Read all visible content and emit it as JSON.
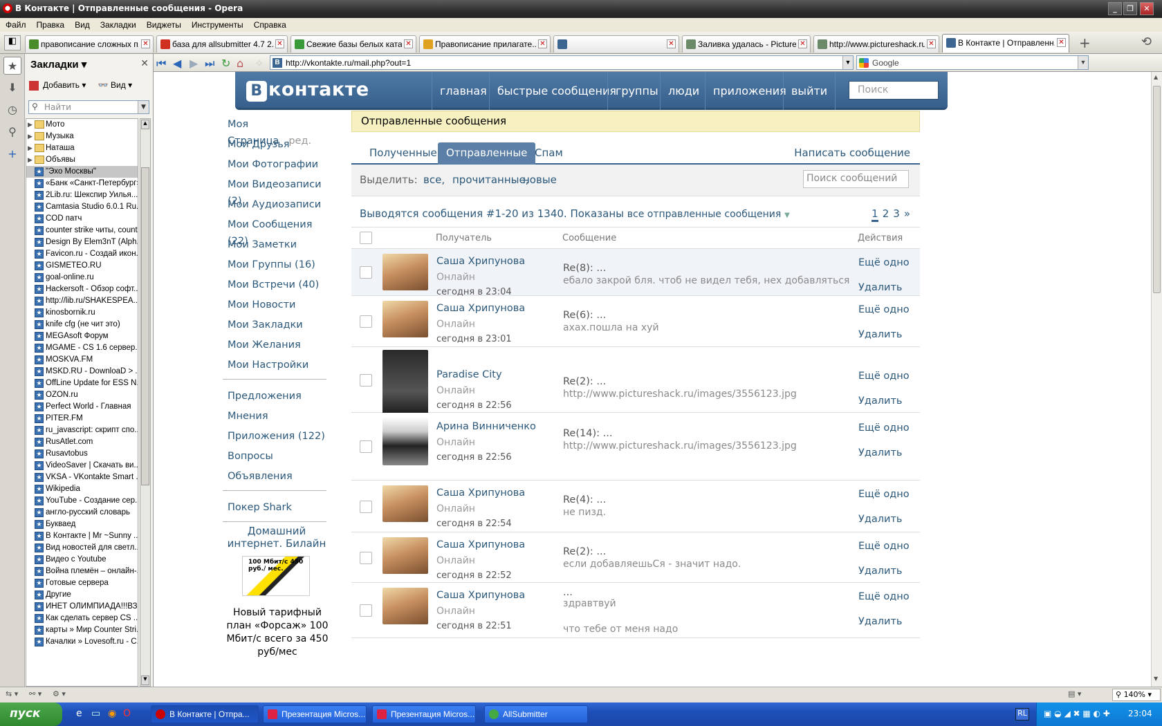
{
  "window": {
    "title": "В Контакте | Отправленные сообщения - Opera"
  },
  "menu": [
    "Файл",
    "Правка",
    "Вид",
    "Закладки",
    "Виджеты",
    "Инструменты",
    "Справка"
  ],
  "tabs": [
    {
      "label": "правописание сложных п...",
      "color": "#4a8c2a"
    },
    {
      "label": "база для allsubmitter 4.7 2...",
      "color": "#d03020"
    },
    {
      "label": "Свежие базы белых ката...",
      "color": "#3a9a3a"
    },
    {
      "label": "Правописание прилагате...",
      "color": "#e0a020"
    },
    {
      "label": "",
      "color": "#3d6592"
    },
    {
      "label": "Заливка удалась - Picture...",
      "color": "#6a8a6a"
    },
    {
      "label": "http://www.pictureshack.ru...",
      "color": "#6a8a6a"
    },
    {
      "label": "В Контакте | Отправленн...",
      "color": "#3d6592"
    }
  ],
  "bookmarks": {
    "title": "Закладки",
    "add": "Добавить",
    "view": "Вид",
    "search_placeholder": "Найти",
    "folders": [
      "Мото",
      "Музыка",
      "Наташа",
      "Объявы"
    ],
    "items": [
      "\"Эхо Москвы\"",
      "«Банк «Санкт-Петербург»",
      "2Lib.ru: Шекспир Уилья...",
      "Camtasia Studio 6.0.1 Ru...",
      "COD  патч",
      "counter strike читы, count...",
      "Design By Elem3nT (Alph...",
      "Favicon.ru - Создай икон...",
      "GISMETEO.RU",
      "goal-online.ru",
      "Hackersoft - Обзор софт...",
      "http://lib.ru/SHAKESPEA...",
      "kinosbornik.ru",
      "knife cfg (не чит это)",
      "MEGAsoft Форум",
      "MGAME - CS 1.6 сервер...",
      "MOSKVA.FM",
      "MSKD.RU - DownloaD > ...",
      "OffLine Update for ESS N...",
      "OZON.ru",
      "Perfect World - Главная",
      "PITER.FM",
      "ru_javascript: скрипт спо...",
      "RusAtlet.com",
      "Rusavtobus",
      "VideoSaver | Скачать ви...",
      "VKSA - VKontakte Smart ...",
      "Wikipedia",
      "YouTube - Создание сер...",
      "англо-русский словарь",
      "Букваед",
      "В Контакте | Mr ~Sunny ...",
      "Вид новостей для светл...",
      "Видео с Youtube",
      "Война племён – онлайн-...",
      "Готовые сервера",
      "Другие",
      "ИНЕТ ОЛИМПИАДА!!!ВЗ...",
      "Как сделать сервер CS ...",
      "карты » Мир Counter Stri...",
      "Качалки » Lovesoft.ru - С..."
    ]
  },
  "address": {
    "url": "http://vkontakte.ru/mail.php?out=1",
    "search": "Google"
  },
  "vk": {
    "logo": "контакте",
    "logo_letter": "В",
    "nav": [
      "главная",
      "быстрые сообщения",
      "группы",
      "люди",
      "приложения",
      "выйти"
    ],
    "search_placeholder": "Поиск",
    "left_menu": [
      "Моя Страница",
      "Мои Друзья",
      "Мои Фотографии",
      "Мои Видеозаписи (2)",
      "Мои Аудиозаписи",
      "Мои Сообщения (22)",
      "Мои Заметки",
      "Мои Группы (16)",
      "Мои Встречи (40)",
      "Мои Новости",
      "Мои Закладки",
      "Мои Желания",
      "Мои Настройки"
    ],
    "edit_label": "ред.",
    "left_menu2": [
      "Предложения",
      "Мнения",
      "Приложения (122)",
      "Вопросы",
      "Объявления"
    ],
    "left_menu3": [
      "Покер Shark"
    ],
    "ad": {
      "title": "Домашний интернет. Билайн",
      "img_text": "100 Мбит/с 450 руб./ мес.",
      "text": "Новый тарифный план «Форсаж» 100 Мбит/с всего за 450 руб/мес"
    },
    "header": "Отправленные сообщения",
    "mail_tabs": [
      "Полученные",
      "Отправленные",
      "Спам"
    ],
    "compose": "Написать сообщение",
    "filter": {
      "label": "Выделить:",
      "links": [
        "все,",
        "прочитанные,",
        "новые"
      ],
      "search_placeholder": "Поиск сообщений"
    },
    "counter": "Выводятся сообщения #1-20 из 1340. Показаны",
    "counter_filter": "все отправленные сообщения",
    "pages": [
      "1",
      "2",
      "3",
      "»"
    ],
    "columns": {
      "recipient": "Получатель",
      "message": "Сообщение",
      "actions": "Действия"
    },
    "messages": [
      {
        "name": "Саша Хрипунова",
        "status": "Онлайн",
        "date": "сегодня в 23:04",
        "re": "Re(8): ...",
        "body": "ебало закрой бля. чтоб не видел тебя, нех добавляться",
        "a1": "Ещё одно",
        "a2": "Удалить"
      },
      {
        "name": "Саша Хрипунова",
        "status": "Онлайн",
        "date": "сегодня в 23:01",
        "re": "Re(6): ...",
        "body": "ахах.пошла на хуй",
        "a1": "Ещё одно",
        "a2": "Удалить"
      },
      {
        "name": "Paradise City",
        "status": "Онлайн",
        "date": "сегодня в 22:56",
        "re": "Re(2): ...",
        "body": "http://www.pictureshack.ru/images/3556123.jpg",
        "a1": "Ещё одно",
        "a2": "Удалить"
      },
      {
        "name": "Арина Винниченко",
        "status": "Онлайн",
        "date": "сегодня в 22:56",
        "re": "Re(14): ...",
        "body": "http://www.pictureshack.ru/images/3556123.jpg",
        "a1": "Ещё одно",
        "a2": "Удалить"
      },
      {
        "name": "Саша Хрипунова",
        "status": "Онлайн",
        "date": "сегодня в 22:54",
        "re": "Re(4): ...",
        "body": "не пизд.",
        "a1": "Ещё одно",
        "a2": "Удалить"
      },
      {
        "name": "Саша Хрипунова",
        "status": "Онлайн",
        "date": "сегодня в 22:52",
        "re": "Re(2): ...",
        "body": "если добавляешьСя - значит надо.",
        "a1": "Ещё одно",
        "a2": "Удалить"
      },
      {
        "name": "Саша Хрипунова",
        "status": "Онлайн",
        "date": "сегодня в 22:51",
        "re": "...",
        "body": "здравтвуй",
        "body2": "что тебе от меня надо",
        "a1": "Ещё одно",
        "a2": "Удалить"
      }
    ]
  },
  "statusbar": {
    "zoom": "140%"
  },
  "taskbar": {
    "start": "пуск",
    "tasks": [
      "В Контакте | Отпра...",
      "Презентация Micros...",
      "Презентация Micros...",
      "AllSubmitter"
    ],
    "lang": "RL",
    "clock": "23:04"
  }
}
